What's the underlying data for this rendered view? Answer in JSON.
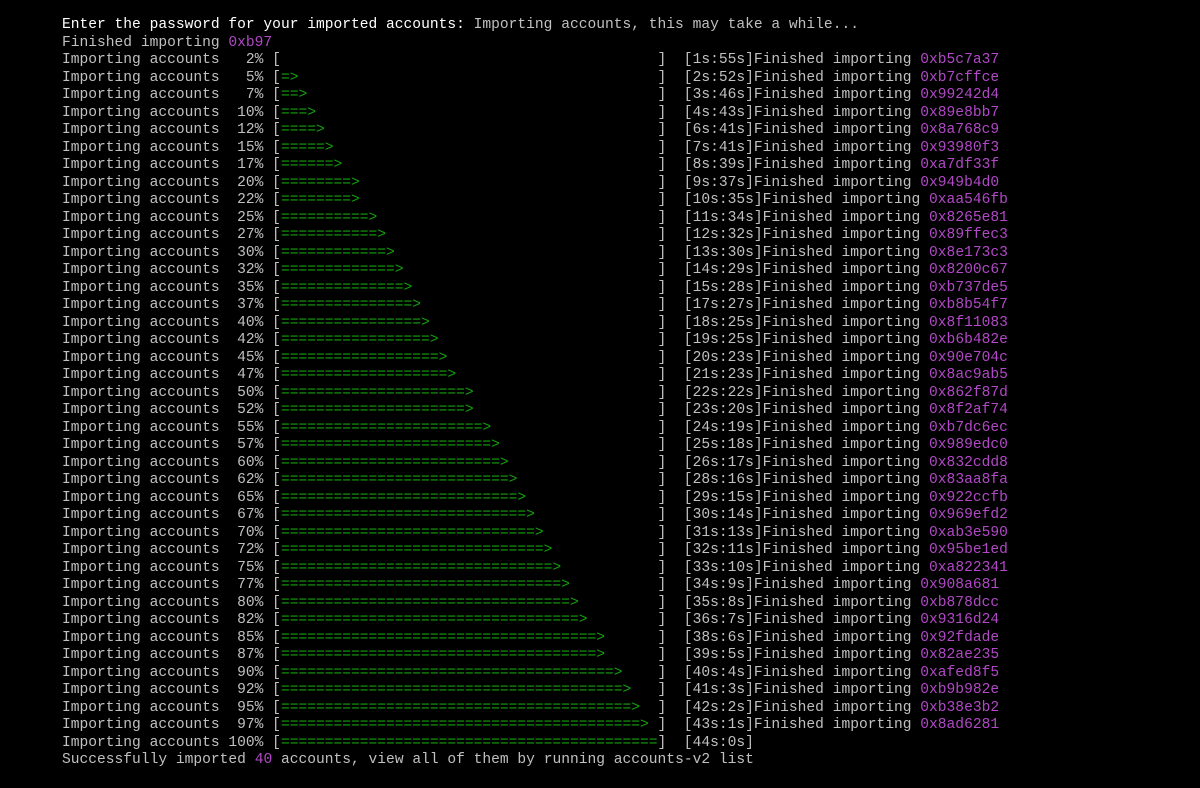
{
  "terminal": {
    "prompt_text": "Enter the password for your imported accounts:",
    "prompt_status": "Importing accounts, this may take a while...",
    "first_finished_label": "Finished importing",
    "first_finished_addr": "0xb97",
    "progress_label": "Importing accounts",
    "finished_label": "Finished importing",
    "bar_width": 43,
    "rows": [
      {
        "pct": "2%",
        "time": "1s:55s",
        "addr": "0xb5c7a37"
      },
      {
        "pct": "5%",
        "time": "2s:52s",
        "addr": "0xb7cffce"
      },
      {
        "pct": "7%",
        "time": "3s:46s",
        "addr": "0x99242d4"
      },
      {
        "pct": "10%",
        "time": "4s:43s",
        "addr": "0x89e8bb7"
      },
      {
        "pct": "12%",
        "time": "6s:41s",
        "addr": "0x8a768c9"
      },
      {
        "pct": "15%",
        "time": "7s:41s",
        "addr": "0x93980f3"
      },
      {
        "pct": "17%",
        "time": "8s:39s",
        "addr": "0xa7df33f"
      },
      {
        "pct": "20%",
        "time": "9s:37s",
        "addr": "0x949b4d0"
      },
      {
        "pct": "22%",
        "time": "10s:35s",
        "addr": "0xaa546fb"
      },
      {
        "pct": "25%",
        "time": "11s:34s",
        "addr": "0x8265e81"
      },
      {
        "pct": "27%",
        "time": "12s:32s",
        "addr": "0x89ffec3"
      },
      {
        "pct": "30%",
        "time": "13s:30s",
        "addr": "0x8e173c3"
      },
      {
        "pct": "32%",
        "time": "14s:29s",
        "addr": "0x8200c67"
      },
      {
        "pct": "35%",
        "time": "15s:28s",
        "addr": "0xb737de5"
      },
      {
        "pct": "37%",
        "time": "17s:27s",
        "addr": "0xb8b54f7"
      },
      {
        "pct": "40%",
        "time": "18s:25s",
        "addr": "0x8f11083"
      },
      {
        "pct": "42%",
        "time": "19s:25s",
        "addr": "0xb6b482e"
      },
      {
        "pct": "45%",
        "time": "20s:23s",
        "addr": "0x90e704c"
      },
      {
        "pct": "47%",
        "time": "21s:23s",
        "addr": "0x8ac9ab5"
      },
      {
        "pct": "50%",
        "time": "22s:22s",
        "addr": "0x862f87d"
      },
      {
        "pct": "52%",
        "time": "23s:20s",
        "addr": "0x8f2af74"
      },
      {
        "pct": "55%",
        "time": "24s:19s",
        "addr": "0xb7dc6ec"
      },
      {
        "pct": "57%",
        "time": "25s:18s",
        "addr": "0x989edc0"
      },
      {
        "pct": "60%",
        "time": "26s:17s",
        "addr": "0x832cdd8"
      },
      {
        "pct": "62%",
        "time": "28s:16s",
        "addr": "0x83aa8fa"
      },
      {
        "pct": "65%",
        "time": "29s:15s",
        "addr": "0x922ccfb"
      },
      {
        "pct": "67%",
        "time": "30s:14s",
        "addr": "0x969efd2"
      },
      {
        "pct": "70%",
        "time": "31s:13s",
        "addr": "0xab3e590"
      },
      {
        "pct": "72%",
        "time": "32s:11s",
        "addr": "0x95be1ed"
      },
      {
        "pct": "75%",
        "time": "33s:10s",
        "addr": "0xa822341"
      },
      {
        "pct": "77%",
        "time": "34s:9s",
        "addr": "0x908a681"
      },
      {
        "pct": "80%",
        "time": "35s:8s",
        "addr": "0xb878dcc"
      },
      {
        "pct": "82%",
        "time": "36s:7s",
        "addr": "0x9316d24"
      },
      {
        "pct": "85%",
        "time": "38s:6s",
        "addr": "0x92fdade"
      },
      {
        "pct": "87%",
        "time": "39s:5s",
        "addr": "0x82ae235"
      },
      {
        "pct": "90%",
        "time": "40s:4s",
        "addr": "0xafed8f5"
      },
      {
        "pct": "92%",
        "time": "41s:3s",
        "addr": "0xb9b982e"
      },
      {
        "pct": "95%",
        "time": "42s:2s",
        "addr": "0xb38e3b2"
      },
      {
        "pct": "97%",
        "time": "43s:1s",
        "addr": "0x8ad6281"
      },
      {
        "pct": "100%",
        "time": "44s:0s",
        "addr": ""
      }
    ],
    "success_prefix": "Successfully imported",
    "success_count": "40",
    "success_suffix": "accounts, view all of them by running accounts-v2 list"
  },
  "colors": {
    "background": "#000000",
    "text": "#c0c0c0",
    "highlight": "#ffffff",
    "bar": "#13a10e",
    "address": "#b148c6"
  }
}
